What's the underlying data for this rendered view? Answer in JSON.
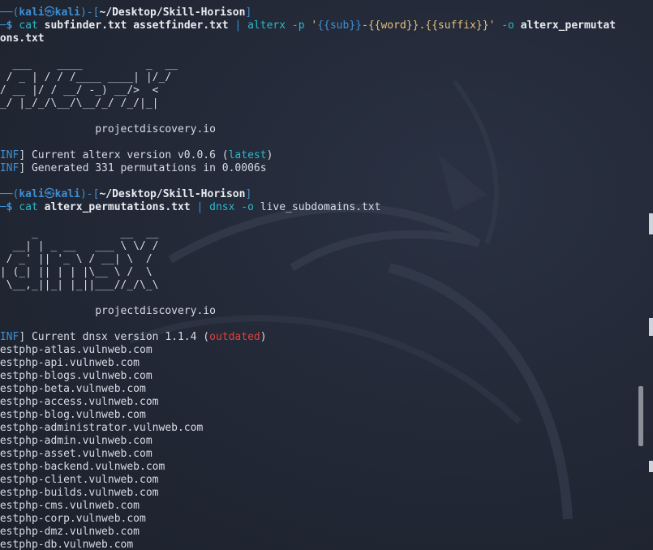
{
  "prompt": {
    "corner_top": "┌──",
    "open": "(",
    "user": "kali",
    "at": "㉿",
    "host": "kali",
    "close": ")-[",
    "path": "~/Desktop/Skill-Horison",
    "end": "]",
    "corner_bottom": "└─",
    "dollar": "$"
  },
  "cmd1": {
    "cat": "cat",
    "file1": "subfinder.txt",
    "file2": "assetfinder.txt",
    "pipe": "|",
    "tool": "alterx",
    "flag_p": "-p",
    "q1": "'",
    "pattern_sub": "{{sub}}",
    "dash": "-",
    "pattern_word": "{{word}}",
    "dot": ".",
    "pattern_suffix": "{{suffix}}",
    "q2": "'",
    "flag_o": "-o",
    "out_head": "alterx_permutat",
    "out_tail": "ions.txt"
  },
  "alterx_banner": [
    "   ___    ____          _  __",
    "  / _ | / / /____ ____| |/_/",
    " / __ |/ / __/ -_) __/>  <",
    "/_/ |_/_/\\__/\\__/_/ /_/|_|"
  ],
  "site": "projectdiscovery.io",
  "alterx_logs": [
    {
      "tag": "INF",
      "text": "Current alterx version v0.0.6 (",
      "status": "latest",
      "tail": ")"
    },
    {
      "tag": "INF",
      "text": "Generated 331 permutations in 0.0006s",
      "status": "",
      "tail": ""
    }
  ],
  "cmd2": {
    "cat": "cat",
    "file": "alterx_permutations.txt",
    "pipe": "|",
    "tool": "dnsx",
    "flag_o": "-o",
    "out": "live_subdomains.txt"
  },
  "dnsx_banner": [
    "      _             __  __",
    "   __| | _ __   ___ \\ \\/ /",
    "  / _' || '_ \\ / __| \\  /",
    " | (_| || | | |\\__ \\ /  \\",
    "  \\__,_||_| |_||___//_/\\_\\"
  ],
  "dnsx_log": {
    "tag": "INF",
    "text": "Current dnsx version 1.1.4 (",
    "status": "outdated",
    "tail": ")"
  },
  "results": [
    "testphp-atlas.vulnweb.com",
    "testphp-api.vulnweb.com",
    "testphp-blogs.vulnweb.com",
    "testphp-beta.vulnweb.com",
    "testphp-access.vulnweb.com",
    "testphp-blog.vulnweb.com",
    "testphp-administrator.vulnweb.com",
    "testphp-admin.vulnweb.com",
    "testphp-asset.vulnweb.com",
    "testphp-backend.vulnweb.com",
    "testphp-client.vulnweb.com",
    "testphp-builds.vulnweb.com",
    "testphp-cms.vulnweb.com",
    "testphp-corp.vulnweb.com",
    "testphp-dmz.vulnweb.com",
    "testphp-db.vulnweb.com"
  ],
  "colors": {
    "background": "#232937",
    "prompt_blue": "#3f8fd2",
    "flag_cyan": "#2bb8c8",
    "pattern_yellow": "#e5c07b",
    "outdated_red": "#e0403a"
  }
}
